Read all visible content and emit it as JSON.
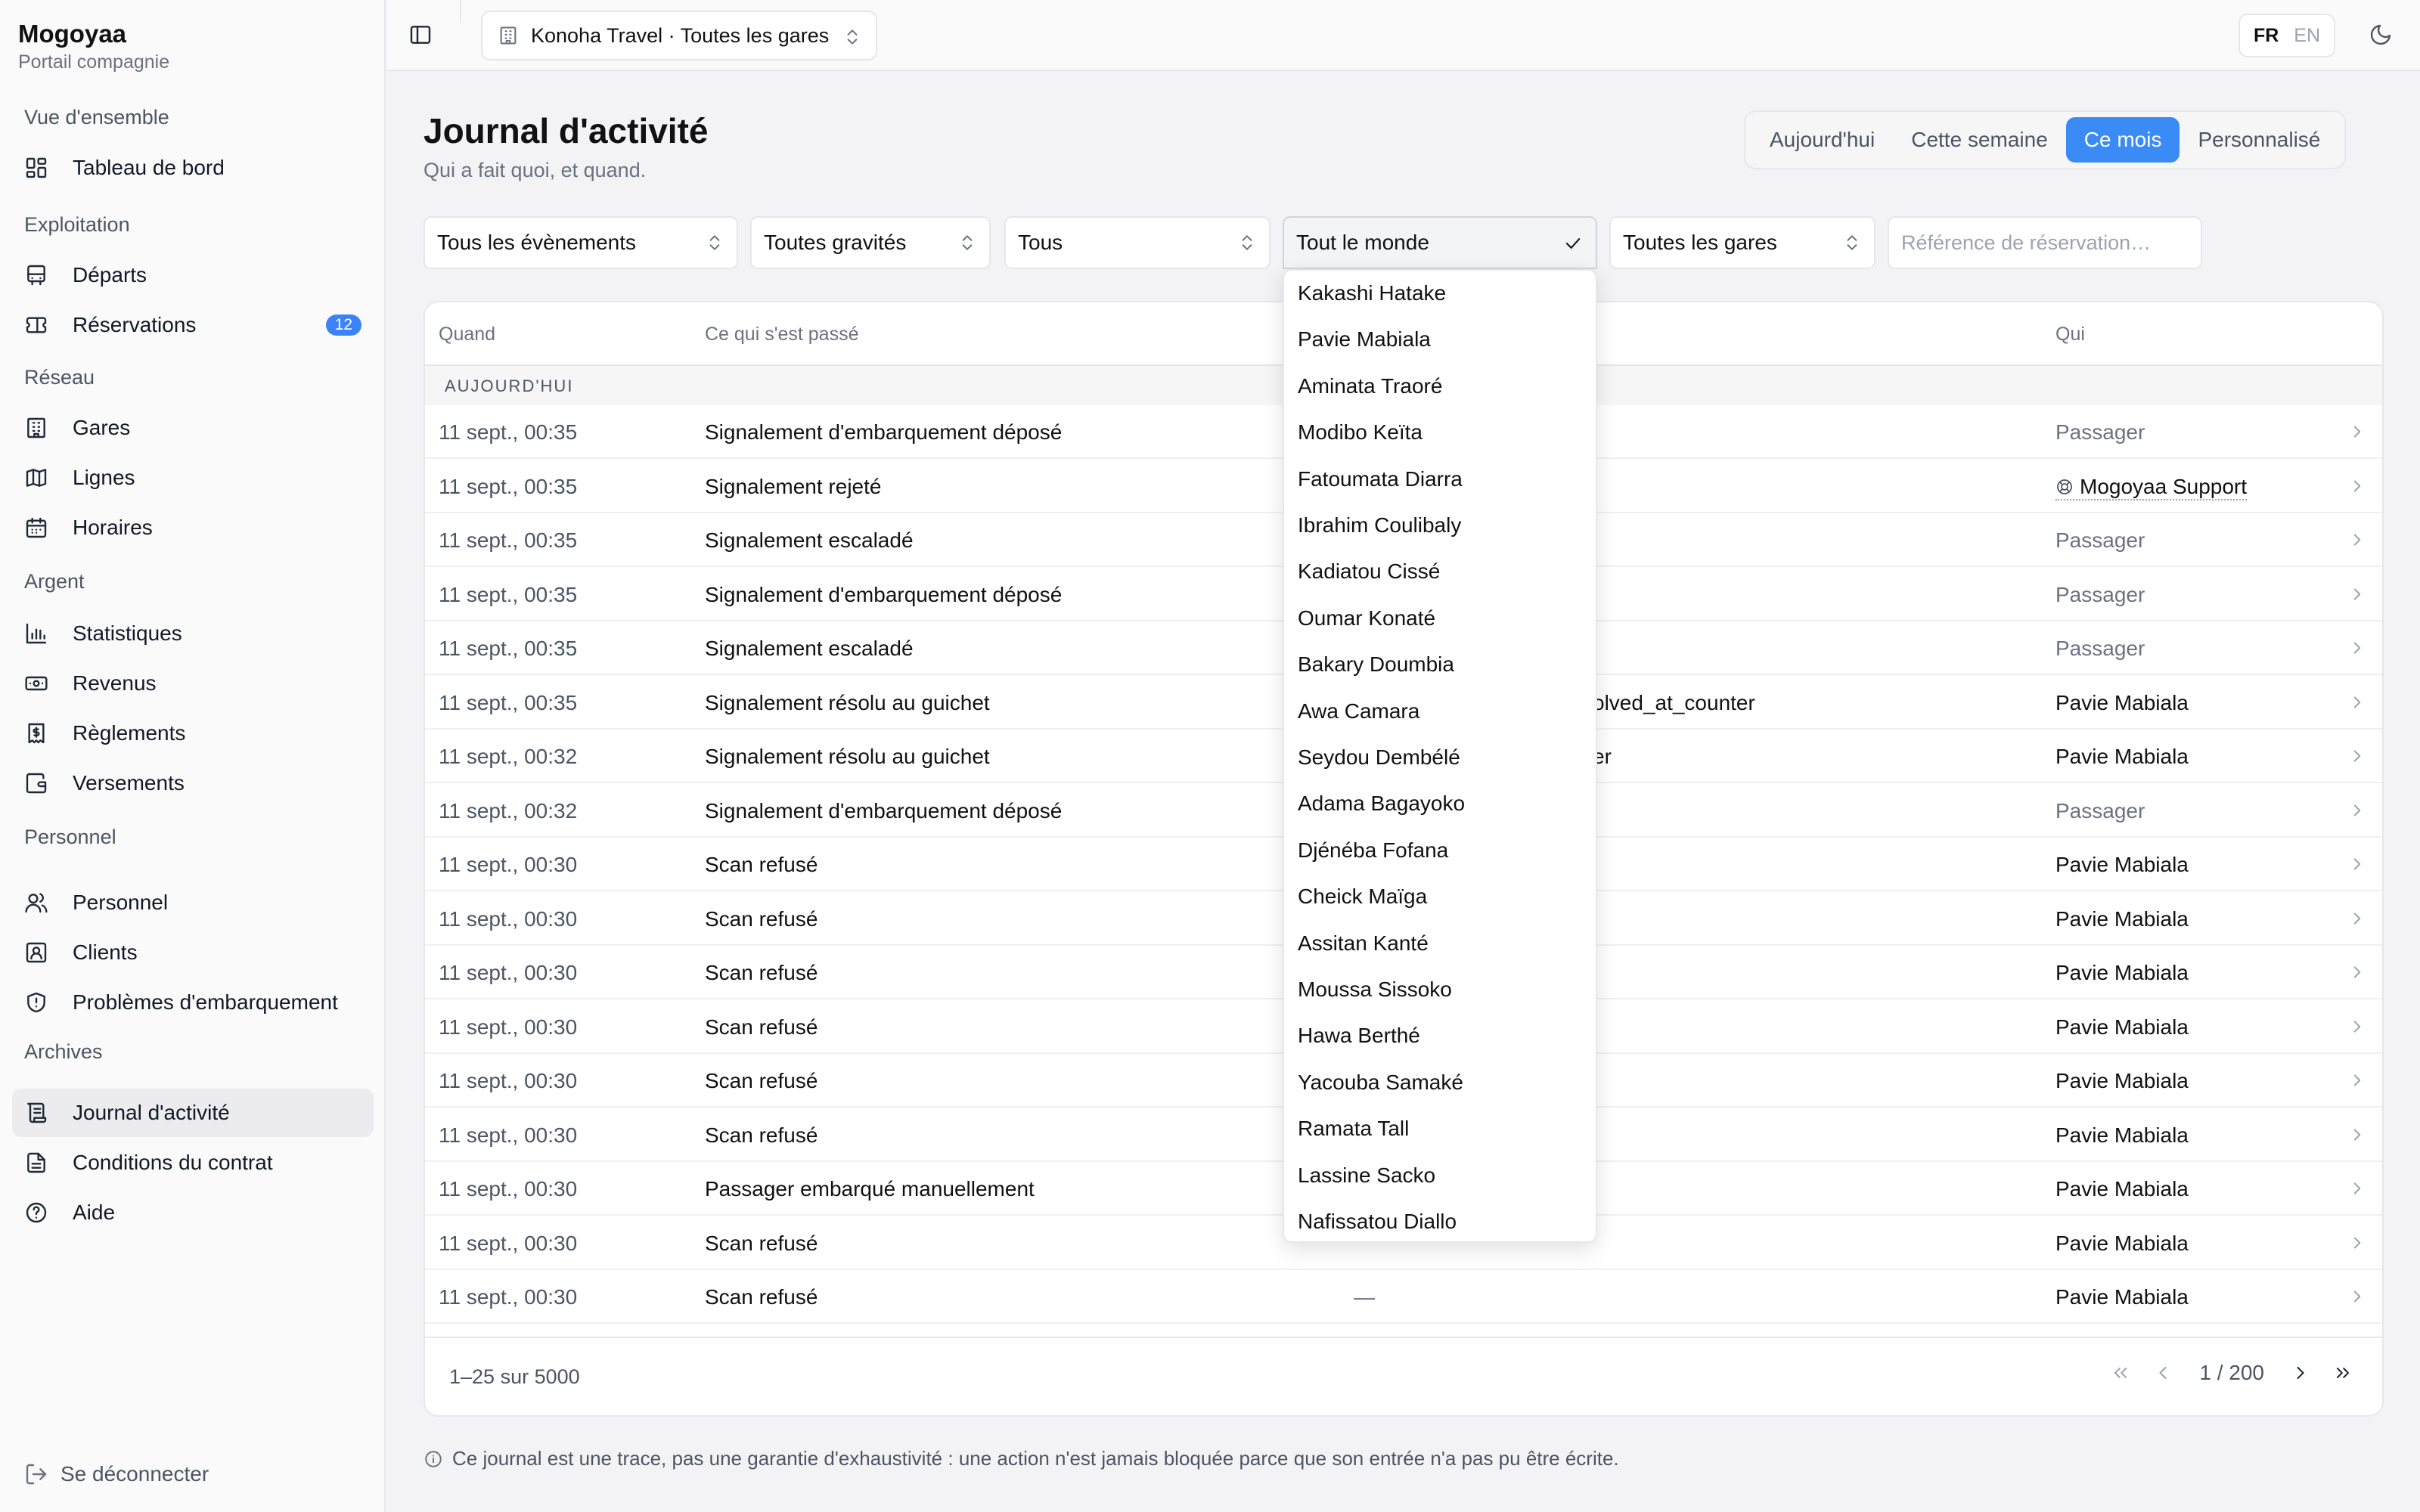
{
  "sidebar": {
    "brand": "Mogoyaa",
    "subtitle": "Portail compagnie",
    "sections": [
      {
        "title": "Vue d'ensemble",
        "items": [
          {
            "label": "Tableau de bord",
            "icon": "dashboard-icon"
          }
        ]
      },
      {
        "title": "Exploitation",
        "items": [
          {
            "label": "Départs",
            "icon": "bus-icon"
          },
          {
            "label": "Réservations",
            "icon": "ticket-icon",
            "badge": "12"
          }
        ]
      },
      {
        "title": "Réseau",
        "items": [
          {
            "label": "Gares",
            "icon": "building-icon"
          },
          {
            "label": "Lignes",
            "icon": "map-icon"
          },
          {
            "label": "Horaires",
            "icon": "calendar-icon"
          }
        ]
      },
      {
        "title": "Argent",
        "items": [
          {
            "label": "Statistiques",
            "icon": "bar-chart-icon"
          },
          {
            "label": "Revenus",
            "icon": "banknote-icon"
          },
          {
            "label": "Règlements",
            "icon": "receipt-icon"
          },
          {
            "label": "Versements",
            "icon": "wallet-icon"
          }
        ]
      },
      {
        "title": "Personnel",
        "items": [
          {
            "label": "Personnel",
            "icon": "users-icon"
          },
          {
            "label": "Clients",
            "icon": "contact-icon"
          },
          {
            "label": "Problèmes d'embarquement",
            "icon": "shield-icon"
          }
        ]
      },
      {
        "title": "Archives",
        "items": [
          {
            "label": "Journal d'activité",
            "icon": "scroll-icon",
            "active": true
          },
          {
            "label": "Conditions du contrat",
            "icon": "file-icon"
          },
          {
            "label": "Aide",
            "icon": "help-icon"
          }
        ]
      }
    ],
    "logout": "Se déconnecter"
  },
  "topbar": {
    "station_selector": "Konoha Travel · Toutes les gares",
    "lang_active": "FR",
    "lang_inactive": "EN"
  },
  "header": {
    "title": "Journal d'activité",
    "subtitle": "Qui a fait quoi, et quand.",
    "periods": [
      "Aujourd'hui",
      "Cette semaine",
      "Ce mois",
      "Personnalisé"
    ],
    "selected_period": "Ce mois"
  },
  "filters": {
    "events": "Tous les évènements",
    "severity": "Toutes gravités",
    "type": "Tous",
    "actor": "Tout le monde",
    "stations": "Toutes les gares",
    "reference_placeholder": "Référence de réservation…"
  },
  "table": {
    "columns": {
      "when": "Quand",
      "what": "Ce qui s'est passé",
      "who": "Qui"
    },
    "group_label": "AUJOURD'HUI",
    "rows": [
      {
        "when": "11 sept., 00:35",
        "what": "Signalement d'embarquement déposé",
        "detail": "",
        "who": "Passager",
        "who_type": "pax"
      },
      {
        "when": "11 sept., 00:35",
        "what": "Signalement rejeté",
        "detail": "",
        "who": "Mogoyaa Support",
        "who_type": "support"
      },
      {
        "when": "11 sept., 00:35",
        "what": "Signalement escaladé",
        "detail": "",
        "who": "Passager",
        "who_type": "pax"
      },
      {
        "when": "11 sept., 00:35",
        "what": "Signalement d'embarquement déposé",
        "detail": "",
        "who": "Passager",
        "who_type": "pax"
      },
      {
        "when": "11 sept., 00:35",
        "what": "Signalement escaladé",
        "detail": "",
        "who": "Passager",
        "who_type": "pax"
      },
      {
        "when": "11 sept., 00:35",
        "what": "Signalement résolu au guichet",
        "detail": "olved_at_counter",
        "who": "Pavie Mabiala",
        "who_type": "staff"
      },
      {
        "when": "11 sept., 00:32",
        "what": "Signalement résolu au guichet",
        "detail": "er",
        "who": "Pavie Mabiala",
        "who_type": "staff"
      },
      {
        "when": "11 sept., 00:32",
        "what": "Signalement d'embarquement déposé",
        "detail": "",
        "who": "Passager",
        "who_type": "pax"
      },
      {
        "when": "11 sept., 00:30",
        "what": "Scan refusé",
        "detail": "",
        "who": "Pavie Mabiala",
        "who_type": "staff"
      },
      {
        "when": "11 sept., 00:30",
        "what": "Scan refusé",
        "detail": "",
        "who": "Pavie Mabiala",
        "who_type": "staff"
      },
      {
        "when": "11 sept., 00:30",
        "what": "Scan refusé",
        "detail": "",
        "who": "Pavie Mabiala",
        "who_type": "staff"
      },
      {
        "when": "11 sept., 00:30",
        "what": "Scan refusé",
        "detail": "",
        "who": "Pavie Mabiala",
        "who_type": "staff"
      },
      {
        "when": "11 sept., 00:30",
        "what": "Scan refusé",
        "detail": "",
        "who": "Pavie Mabiala",
        "who_type": "staff"
      },
      {
        "when": "11 sept., 00:30",
        "what": "Scan refusé",
        "detail": "",
        "who": "Pavie Mabiala",
        "who_type": "staff"
      },
      {
        "when": "11 sept., 00:30",
        "what": "Passager embarqué manuellement",
        "detail": "",
        "who": "Pavie Mabiala",
        "who_type": "staff"
      },
      {
        "when": "11 sept., 00:30",
        "what": "Scan refusé",
        "detail": "",
        "who": "Pavie Mabiala",
        "who_type": "staff"
      },
      {
        "when": "11 sept., 00:30",
        "what": "Scan refusé",
        "detail": "—",
        "who": "Pavie Mabiala",
        "who_type": "staff"
      }
    ],
    "count_label": "1–25 sur 5000",
    "page_label": "1 / 200"
  },
  "dropdown": {
    "options": [
      "Kakashi Hatake",
      "Pavie Mabiala",
      "Aminata Traoré",
      "Modibo Keïta",
      "Fatoumata Diarra",
      "Ibrahim Coulibaly",
      "Kadiatou Cissé",
      "Oumar Konaté",
      "Bakary Doumbia",
      "Awa Camara",
      "Seydou Dembélé",
      "Adama Bagayoko",
      "Djénéba Fofana",
      "Cheick Maïga",
      "Assitan Kanté",
      "Moussa Sissoko",
      "Hawa Berthé",
      "Yacouba Samaké",
      "Ramata Tall",
      "Lassine Sacko",
      "Nafissatou Diallo"
    ]
  },
  "footnote": "Ce journal est une trace, pas une garantie d'exhaustivité : une action n'est jamais bloquée parce que son entrée n'a pas pu être écrite.",
  "colors": {
    "accent": "#3b8bf6",
    "badge": "#3b82f6"
  }
}
